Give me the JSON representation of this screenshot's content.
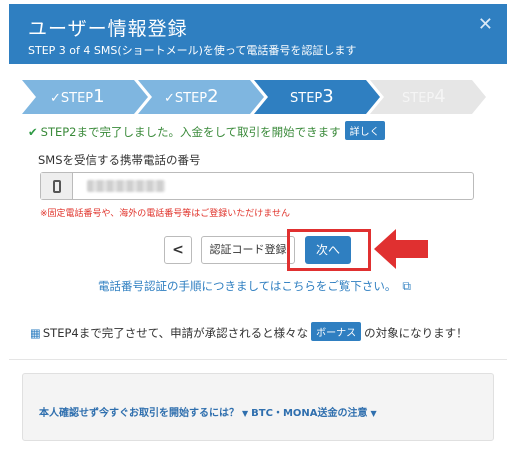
{
  "header": {
    "title": "ユーザー情報登録",
    "subtitle": "STEP 3 of 4 SMS(ショートメール)を使って電話番号を認証します",
    "close_icon": "close-icon"
  },
  "steps": [
    {
      "prefix": "✓STEP",
      "num": "1",
      "state": "done"
    },
    {
      "prefix": "✓STEP",
      "num": "2",
      "state": "done"
    },
    {
      "prefix": "STEP",
      "num": "3",
      "state": "current"
    },
    {
      "prefix": "STEP",
      "num": "4",
      "state": "todo"
    }
  ],
  "status": {
    "text": "STEP2まで完了しました。入金をして取引を開始できます",
    "detail_button": "詳しく"
  },
  "phone": {
    "label": "SMSを受信する携帯電話の番号",
    "value": "",
    "icon": "mobile-phone-icon",
    "note": "※固定電話番号や、海外の電話番号等はご登録いただけません"
  },
  "buttons": {
    "back": "<",
    "send_code": "認証コード登録",
    "next": "次へ"
  },
  "help_link": {
    "text": "電話番号認証の手順につきましてはこちらをご覧下さい。",
    "icon": "external-link-icon"
  },
  "bonus": {
    "pre": "STEP4まで完了させて、申請が承認されると様々な",
    "badge": "ボーナス",
    "post": "の対象になります！",
    "icon": "gift-icon"
  },
  "footer": {
    "link1": "本人確認せず今すぐお取引を開始するには？",
    "link2": "BTC・MONA送金の注意"
  },
  "colors": {
    "primary": "#2f7fc1",
    "step_done": "#7fb6e0",
    "step_todo": "#e6e6e6",
    "success": "#3a8a3a",
    "warning": "#e0332b",
    "annotation": "#e03030"
  }
}
